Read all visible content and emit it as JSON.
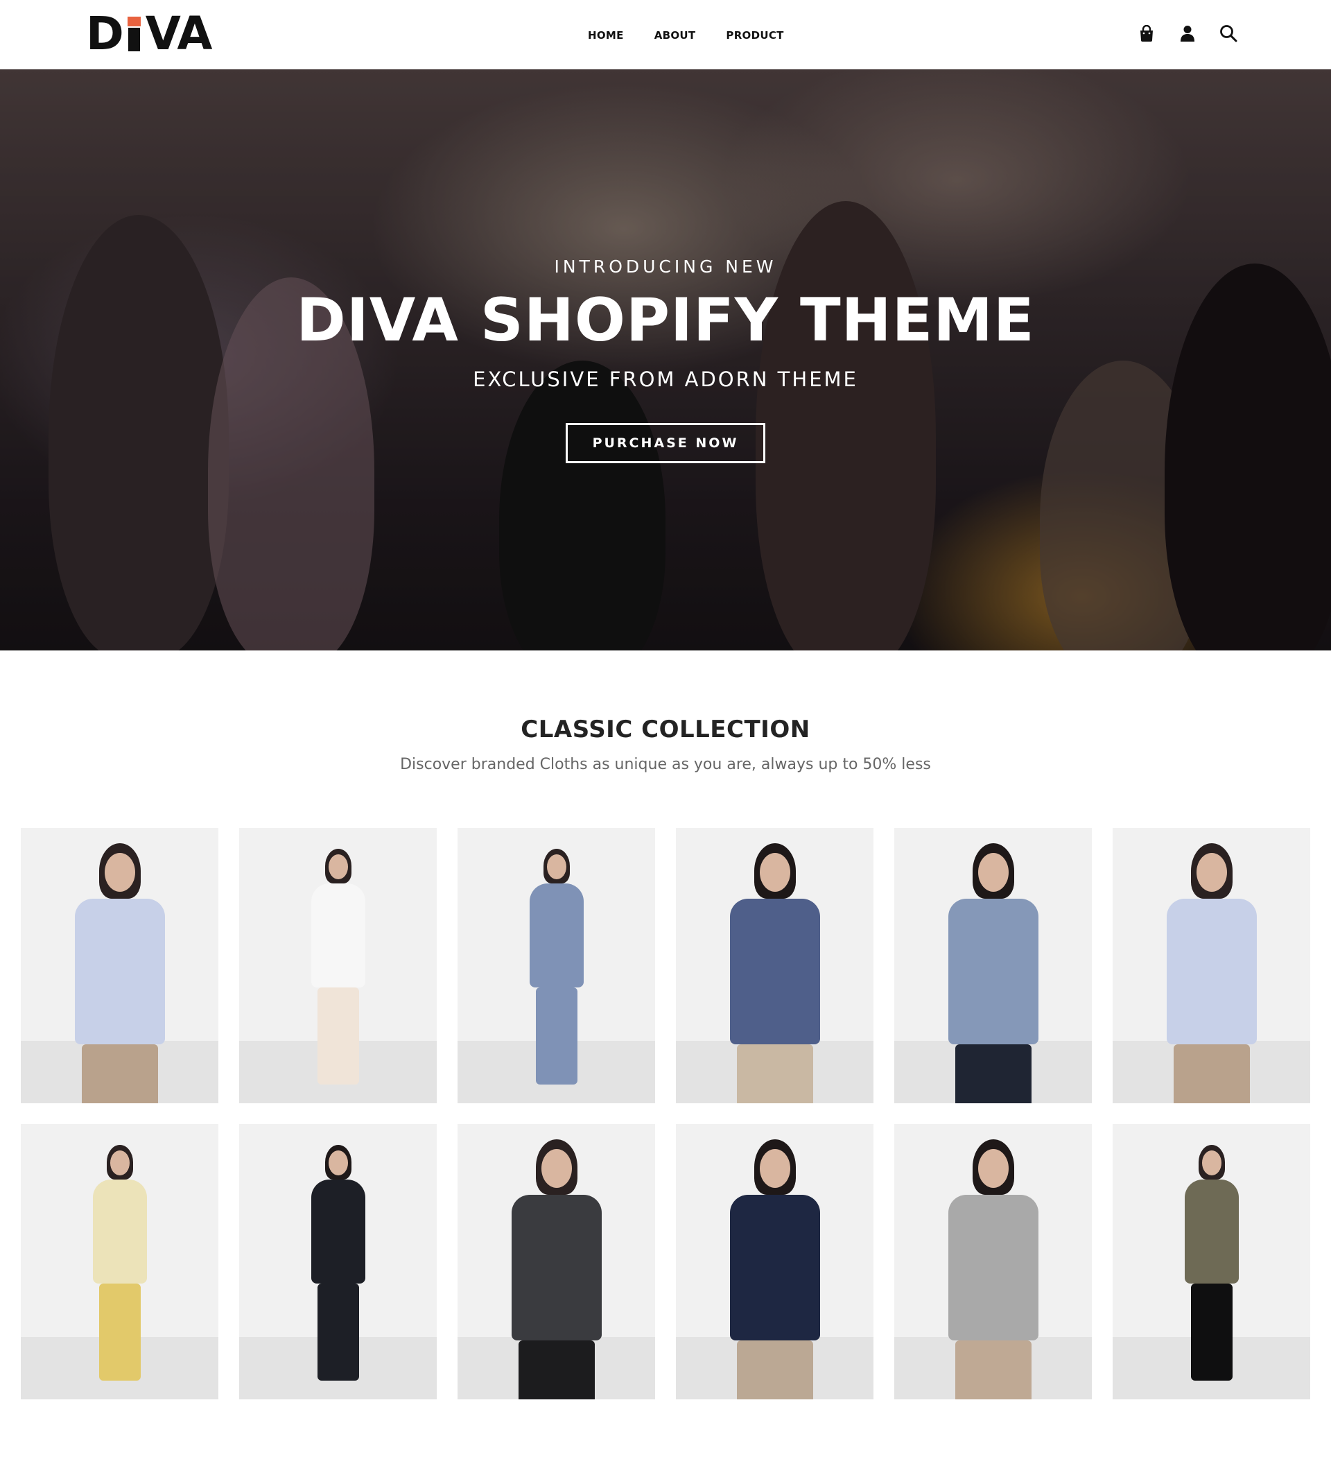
{
  "brand": {
    "logo_text_before": "D",
    "logo_text_after": "VA",
    "accent_color": "#e8623f"
  },
  "nav": {
    "items": [
      {
        "label": "HOME"
      },
      {
        "label": "ABOUT"
      },
      {
        "label": "PRODUCT"
      }
    ]
  },
  "header_icons": [
    "shopping-bag-icon",
    "user-icon",
    "search-icon"
  ],
  "hero": {
    "eyebrow": "INTRODUCING NEW",
    "title": "DIVA SHOPIFY THEME",
    "subtitle": "EXCLUSIVE FROM ADORN THEME",
    "cta_label": "PURCHASE NOW"
  },
  "collection": {
    "title": "CLASSIC COLLECTION",
    "subtitle": "Discover branded Cloths as unique as you are, always up to 50% less",
    "products": [
      {
        "top": "#c7d0e8",
        "bottom": "#b9a28c",
        "hair": "#2a2121",
        "pose": "top"
      },
      {
        "top": "#f7f7f7",
        "bottom": "#f0e4d8",
        "hair": "#2a2121",
        "pose": "full"
      },
      {
        "top": "#7f92b6",
        "bottom": "#7f92b6",
        "hair": "#2a2121",
        "pose": "full"
      },
      {
        "top": "#4f5f8a",
        "bottom": "#c9b8a3",
        "hair": "#1e1818",
        "pose": "top"
      },
      {
        "top": "#8598b8",
        "bottom": "#1f2533",
        "hair": "#1e1818",
        "pose": "top"
      },
      {
        "top": "#c7d0e8",
        "bottom": "#b9a28c",
        "hair": "#2a2121",
        "pose": "top"
      },
      {
        "top": "#ece3b9",
        "bottom": "#e2c96a",
        "hair": "#2a2121",
        "pose": "full"
      },
      {
        "top": "#1d1f26",
        "bottom": "#1d1f26",
        "hair": "#1e1818",
        "pose": "full"
      },
      {
        "top": "#3a3b3f",
        "bottom": "#1c1c1e",
        "hair": "#2a2121",
        "pose": "top"
      },
      {
        "top": "#1e2742",
        "bottom": "#bba894",
        "hair": "#1e1818",
        "pose": "top"
      },
      {
        "top": "#a9a9a9",
        "bottom": "#bfa994",
        "hair": "#1e1818",
        "pose": "top"
      },
      {
        "top": "#6e6a55",
        "bottom": "#0f0f10",
        "hair": "#2a2121",
        "pose": "full"
      }
    ]
  }
}
